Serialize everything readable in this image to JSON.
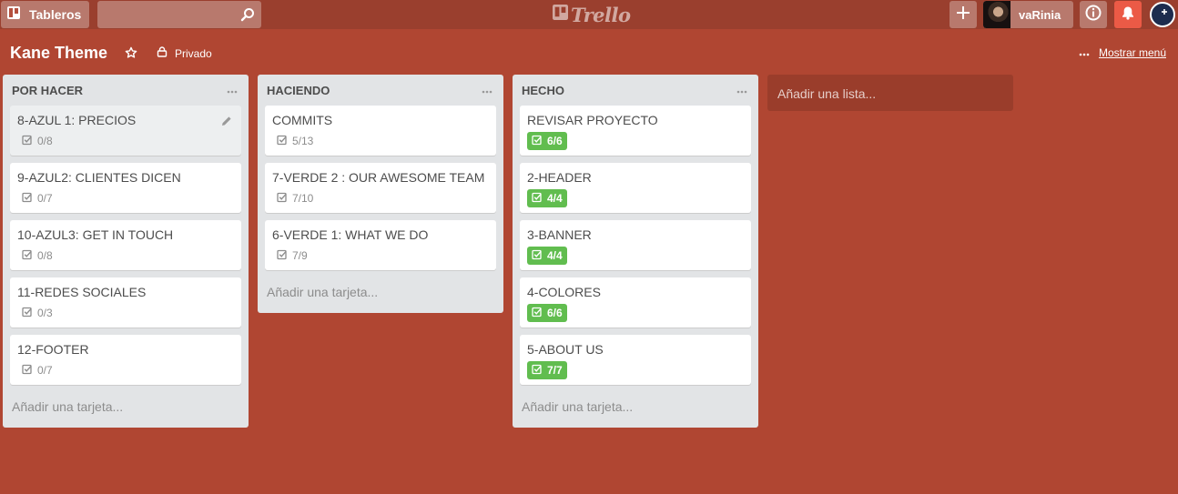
{
  "topbar": {
    "boards_label": "Tableros",
    "search_placeholder": "",
    "logo_text": "Trello",
    "username": "vaRinia"
  },
  "board": {
    "title": "Kane Theme",
    "privacy_label": "Privado",
    "menu_label": "Mostrar menú"
  },
  "lists": [
    {
      "title": "POR HACER",
      "add_card_label": "Añadir una tarjeta...",
      "cards": [
        {
          "title": "8-AZUL 1: PRECIOS",
          "checklist": "0/8",
          "complete": false
        },
        {
          "title": "9-AZUL2: CLIENTES DICEN",
          "checklist": "0/7",
          "complete": false
        },
        {
          "title": "10-AZUL3: GET IN TOUCH",
          "checklist": "0/8",
          "complete": false
        },
        {
          "title": "11-REDES SOCIALES",
          "checklist": "0/3",
          "complete": false
        },
        {
          "title": "12-FOOTER",
          "checklist": "0/7",
          "complete": false
        }
      ]
    },
    {
      "title": "HACIENDO",
      "add_card_label": "Añadir una tarjeta...",
      "cards": [
        {
          "title": "COMMITS",
          "checklist": "5/13",
          "complete": false
        },
        {
          "title": "7-VERDE 2 : OUR AWESOME TEAM",
          "checklist": "7/10",
          "complete": false
        },
        {
          "title": "6-VERDE 1: WHAT WE DO",
          "checklist": "7/9",
          "complete": false
        }
      ]
    },
    {
      "title": "HECHO",
      "add_card_label": "Añadir una tarjeta...",
      "cards": [
        {
          "title": "REVISAR PROYECTO",
          "checklist": "6/6",
          "complete": true
        },
        {
          "title": "2-HEADER",
          "checklist": "4/4",
          "complete": true
        },
        {
          "title": "3-BANNER",
          "checklist": "4/4",
          "complete": true
        },
        {
          "title": "4-COLORES",
          "checklist": "6/6",
          "complete": true
        },
        {
          "title": "5-ABOUT US",
          "checklist": "7/7",
          "complete": true
        }
      ]
    }
  ],
  "add_list_label": "Añadir una lista...",
  "colors": {
    "board_background": "#b04632",
    "header_background": "#9a3f2e",
    "notification_button": "#eb5a46",
    "checklist_complete": "#61bd4f"
  },
  "icons": {
    "boards": "boards-icon",
    "search": "search-icon",
    "add": "plus-icon",
    "info": "info-icon",
    "notifications": "bell-icon",
    "star": "star-icon",
    "privacy": "lock-icon",
    "menu": "more-icon",
    "checklist": "checklist-icon",
    "edit": "pencil-icon"
  }
}
